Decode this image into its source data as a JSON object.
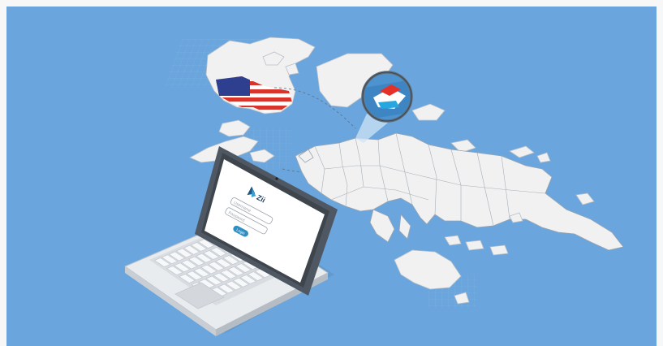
{
  "scene": {
    "background_color": "#6aa6dd",
    "land_color": "#f1f1f1",
    "border_color": "#9aa4ae",
    "highlight_country": "Luxembourg",
    "highlight_flag": "usa-flag"
  },
  "laptop": {
    "logo_text": "Zii",
    "username_placeholder": "Username",
    "password_placeholder": "Password",
    "login_label": "Login",
    "accent_color": "#2f8fc3"
  },
  "magnifier": {
    "subject": "luxembourg-flag-map",
    "colors": {
      "red": "#e4322b",
      "white": "#ffffff",
      "blue": "#28a6df"
    }
  }
}
